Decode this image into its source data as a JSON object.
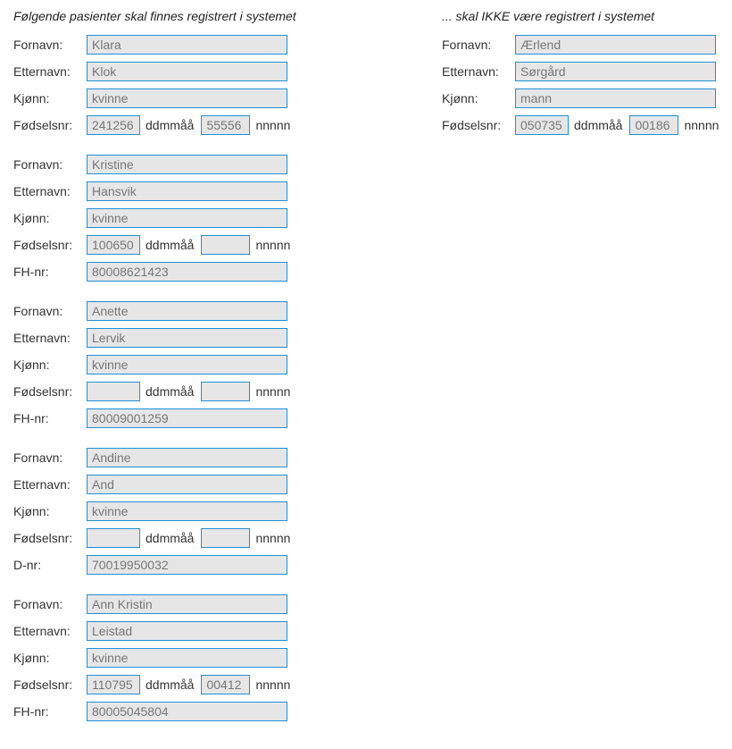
{
  "headings": {
    "registered": "Følgende pasienter skal finnes registrert i systemet",
    "notRegistered": "... skal IKKE være registrert i systemet"
  },
  "labels": {
    "fornavn": "Fornavn:",
    "etternavn": "Etternavn:",
    "kjonn": "Kjønn:",
    "fodselsnr": "Fødselsnr:",
    "fhnr": "FH-nr:",
    "dnr": "D-nr:",
    "ddmmaa": "ddmmåå",
    "nnnnn": "nnnnn"
  },
  "registered": [
    {
      "fornavn": "Klara",
      "etternavn": "Klok",
      "kjonn": "kvinne",
      "fodsel_dd": "241256",
      "fodsel_nn": "55556",
      "extra_label": null,
      "extra_value": null
    },
    {
      "fornavn": "Kristine",
      "etternavn": "Hansvik",
      "kjonn": "kvinne",
      "fodsel_dd": "100650",
      "fodsel_nn": "",
      "extra_label": "fhnr",
      "extra_value": "80008621423"
    },
    {
      "fornavn": "Anette",
      "etternavn": "Lervik",
      "kjonn": "kvinne",
      "fodsel_dd": "",
      "fodsel_nn": "",
      "extra_label": "fhnr",
      "extra_value": "80009001259"
    },
    {
      "fornavn": "Andine",
      "etternavn": "And",
      "kjonn": "kvinne",
      "fodsel_dd": "",
      "fodsel_nn": "",
      "extra_label": "dnr",
      "extra_value": "70019950032"
    },
    {
      "fornavn": "Ann Kristin",
      "etternavn": "Leistad",
      "kjonn": "kvinne",
      "fodsel_dd": "110795",
      "fodsel_nn": "00412",
      "extra_label": "fhnr",
      "extra_value": "80005045804"
    }
  ],
  "notRegistered": [
    {
      "fornavn": "Ærlend",
      "etternavn": "Sørgård",
      "kjonn": "mann",
      "fodsel_dd": "050735",
      "fodsel_nn": "00186",
      "extra_label": null,
      "extra_value": null
    }
  ]
}
